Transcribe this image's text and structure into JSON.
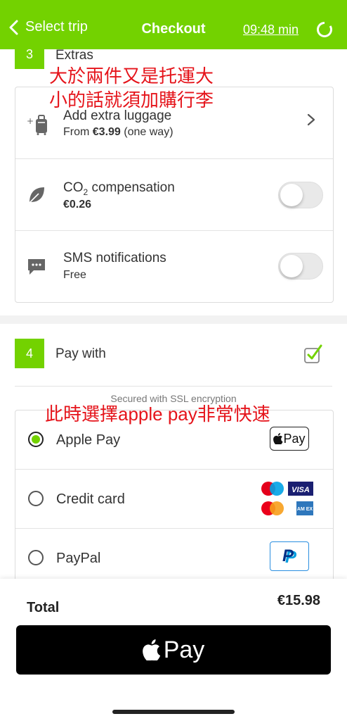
{
  "header": {
    "back_label": "Select trip",
    "title": "Checkout",
    "timer": "09:48 min"
  },
  "extras": {
    "step": "3",
    "label": "Extras",
    "items": [
      {
        "title": "Add extra luggage",
        "sub_prefix": "From ",
        "sub_price": "€3.99",
        "sub_suffix": " (one way)",
        "icon": "luggage-icon",
        "control": "chevron-right-icon"
      },
      {
        "title_main": "CO",
        "title_subscript": "2",
        "title_rest": " compensation",
        "sub_price": "€0.26",
        "icon": "leaf-icon",
        "control": "toggle",
        "toggled": false
      },
      {
        "title": "SMS notifications",
        "sub": "Free",
        "icon": "message-icon",
        "control": "toggle",
        "toggled": false
      }
    ]
  },
  "annotations": {
    "luggage_line1": "大於兩件又是托運大",
    "luggage_line2": "小的話就須加購行李",
    "applepay": "此時選擇apple pay非常快速"
  },
  "payment": {
    "step": "4",
    "label": "Pay with",
    "ssl_note": "Secured with SSL encryption",
    "methods": [
      {
        "label": "Apple Pay",
        "selected": true,
        "badge": "Pay"
      },
      {
        "label": "Credit card",
        "selected": false,
        "badge_visa": "VISA",
        "badge_amex": "AM EX"
      },
      {
        "label": "PayPal",
        "selected": false,
        "badge": "P"
      }
    ]
  },
  "footer": {
    "total_label": "Total",
    "total_value": "€15.98",
    "pay_button": "Pay"
  },
  "colors": {
    "brand_green": "#73d200",
    "annotation_red": "#e5141b"
  }
}
